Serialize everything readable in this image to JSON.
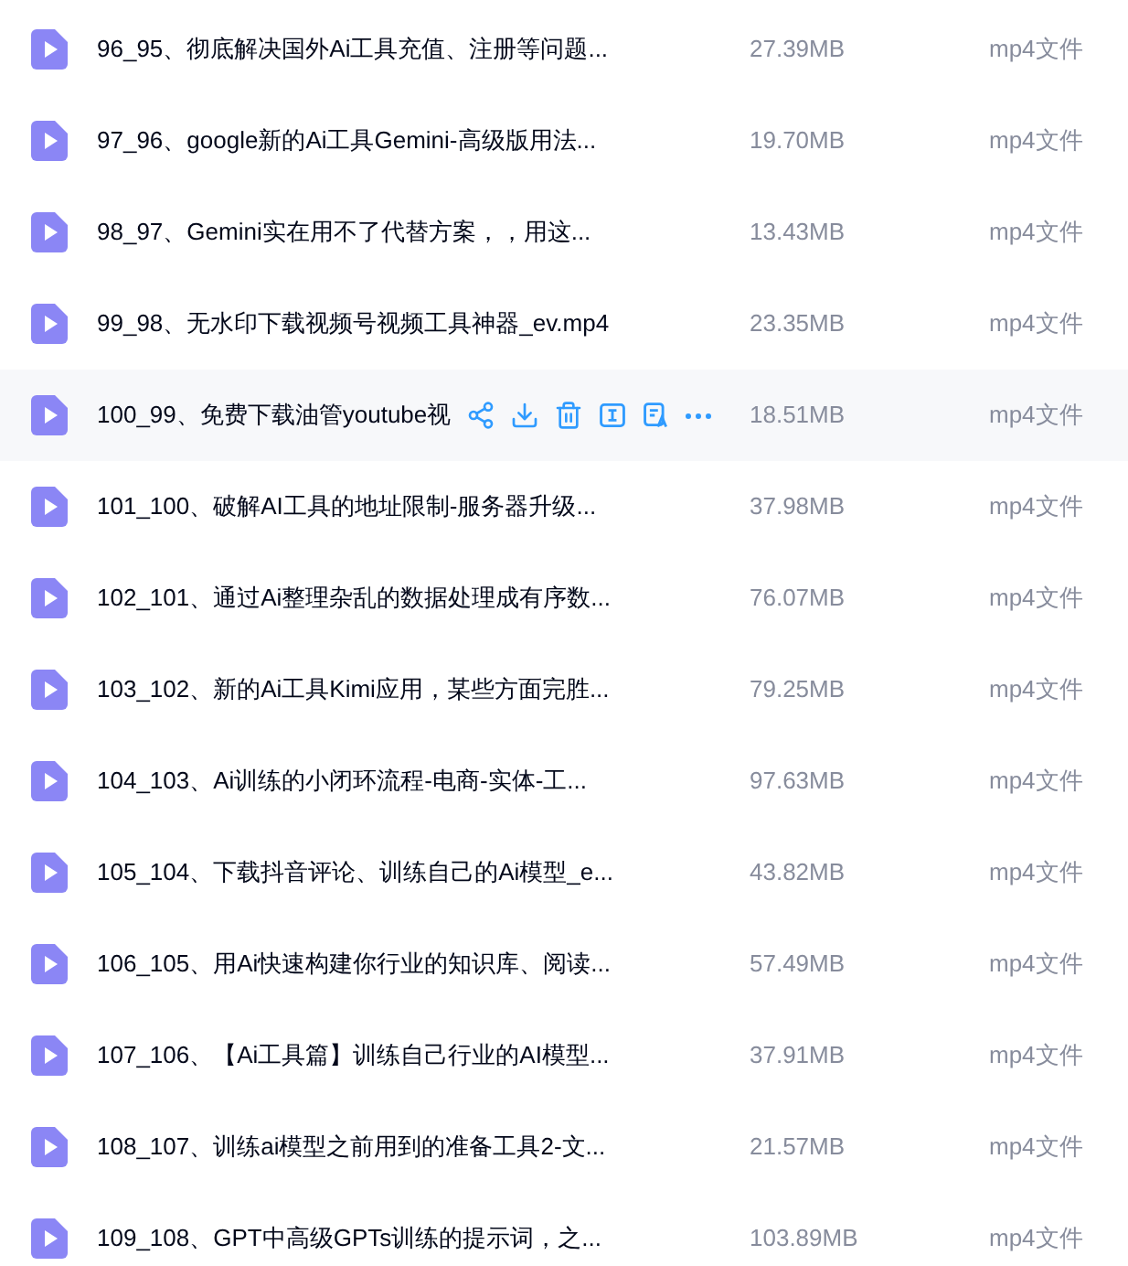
{
  "files": [
    {
      "name": "96_95、彻底解决国外Ai工具充值、注册等问题...",
      "size": "27.39MB",
      "type": "mp4文件",
      "hovered": false
    },
    {
      "name": "97_96、google新的Ai工具Gemini-高级版用法...",
      "size": "19.70MB",
      "type": "mp4文件",
      "hovered": false
    },
    {
      "name": "98_97、Gemini实在用不了代替方案，，用这...",
      "size": "13.43MB",
      "type": "mp4文件",
      "hovered": false
    },
    {
      "name": "99_98、无水印下载视频号视频工具神器_ev.mp4",
      "size": "23.35MB",
      "type": "mp4文件",
      "hovered": false
    },
    {
      "name": "100_99、免费下载油管youtube视",
      "size": "18.51MB",
      "type": "mp4文件",
      "hovered": true
    },
    {
      "name": "101_100、破解AI工具的地址限制-服务器升级...",
      "size": "37.98MB",
      "type": "mp4文件",
      "hovered": false
    },
    {
      "name": "102_101、通过Ai整理杂乱的数据处理成有序数...",
      "size": "76.07MB",
      "type": "mp4文件",
      "hovered": false
    },
    {
      "name": "103_102、新的Ai工具Kimi应用，某些方面完胜...",
      "size": "79.25MB",
      "type": "mp4文件",
      "hovered": false
    },
    {
      "name": "104_103、Ai训练的小闭环流程-电商-实体-工...",
      "size": "97.63MB",
      "type": "mp4文件",
      "hovered": false
    },
    {
      "name": "105_104、下载抖音评论、训练自己的Ai模型_e...",
      "size": "43.82MB",
      "type": "mp4文件",
      "hovered": false
    },
    {
      "name": "106_105、用Ai快速构建你行业的知识库、阅读...",
      "size": "57.49MB",
      "type": "mp4文件",
      "hovered": false
    },
    {
      "name": "107_106、【Ai工具篇】训练自己行业的AI模型...",
      "size": "37.91MB",
      "type": "mp4文件",
      "hovered": false
    },
    {
      "name": "108_107、训练ai模型之前用到的准备工具2-文...",
      "size": "21.57MB",
      "type": "mp4文件",
      "hovered": false
    },
    {
      "name": "109_108、GPT中高级GPTs训练的提示词，之...",
      "size": "103.89MB",
      "type": "mp4文件",
      "hovered": false
    }
  ]
}
